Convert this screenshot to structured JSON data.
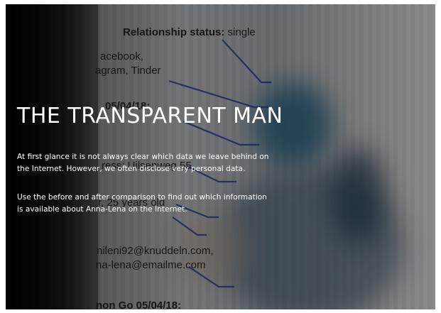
{
  "background": {
    "relationship_label": "Relationship status:",
    "relationship_value": "single",
    "social_line1": "acebook,",
    "social_line2": "agram, Tinder",
    "date_line": "05/04/18:",
    "address_line": "ress: Uilsenweg 55",
    "age_line": "r, 25 years old",
    "email_line1": "nileni92@knuddeln.com,",
    "email_line2": "na-lena@emailme.com",
    "game_line": "non Go 05/04/18:"
  },
  "overlay": {
    "title": "THE TRANSPARENT MAN",
    "paragraph1": "At first glance it is not always clear which data we leave behind on the Internet. However, we often disclose very personal data.",
    "paragraph2": "Use the before and after comparison to find out which information is available about Anna-Lena on the Internet."
  },
  "colors": {
    "connector_line": "#1f2f6e",
    "overlay_text": "#ffffff"
  }
}
